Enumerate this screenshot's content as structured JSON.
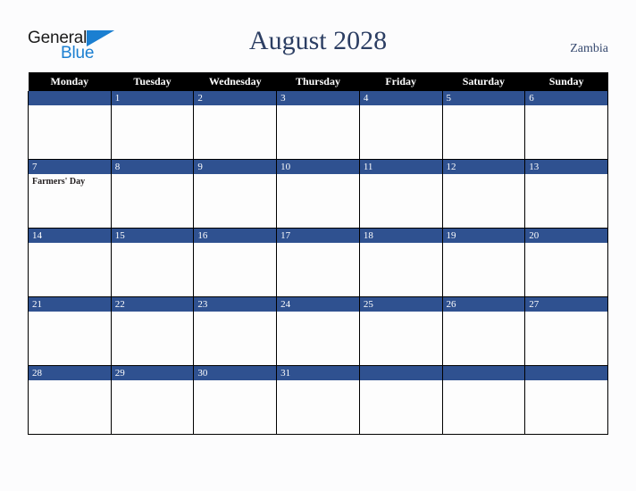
{
  "brand": {
    "logo_text_1": "General",
    "logo_text_2": "Blue",
    "triangle_icon": "triangle-icon",
    "blue_hex": "#1b7fd1"
  },
  "header": {
    "title": "August 2028",
    "country": "Zambia"
  },
  "calendar": {
    "accent_hex": "#2f5190",
    "header_bg_hex": "#000000",
    "weekday_headers": [
      "Monday",
      "Tuesday",
      "Wednesday",
      "Thursday",
      "Friday",
      "Saturday",
      "Sunday"
    ],
    "weeks": [
      [
        {
          "day": "",
          "events": []
        },
        {
          "day": "1",
          "events": []
        },
        {
          "day": "2",
          "events": []
        },
        {
          "day": "3",
          "events": []
        },
        {
          "day": "4",
          "events": []
        },
        {
          "day": "5",
          "events": []
        },
        {
          "day": "6",
          "events": []
        }
      ],
      [
        {
          "day": "7",
          "events": [
            "Farmers' Day"
          ]
        },
        {
          "day": "8",
          "events": []
        },
        {
          "day": "9",
          "events": []
        },
        {
          "day": "10",
          "events": []
        },
        {
          "day": "11",
          "events": []
        },
        {
          "day": "12",
          "events": []
        },
        {
          "day": "13",
          "events": []
        }
      ],
      [
        {
          "day": "14",
          "events": []
        },
        {
          "day": "15",
          "events": []
        },
        {
          "day": "16",
          "events": []
        },
        {
          "day": "17",
          "events": []
        },
        {
          "day": "18",
          "events": []
        },
        {
          "day": "19",
          "events": []
        },
        {
          "day": "20",
          "events": []
        }
      ],
      [
        {
          "day": "21",
          "events": []
        },
        {
          "day": "22",
          "events": []
        },
        {
          "day": "23",
          "events": []
        },
        {
          "day": "24",
          "events": []
        },
        {
          "day": "25",
          "events": []
        },
        {
          "day": "26",
          "events": []
        },
        {
          "day": "27",
          "events": []
        }
      ],
      [
        {
          "day": "28",
          "events": []
        },
        {
          "day": "29",
          "events": []
        },
        {
          "day": "30",
          "events": []
        },
        {
          "day": "31",
          "events": []
        },
        {
          "day": "",
          "events": []
        },
        {
          "day": "",
          "events": []
        },
        {
          "day": "",
          "events": []
        }
      ]
    ]
  }
}
